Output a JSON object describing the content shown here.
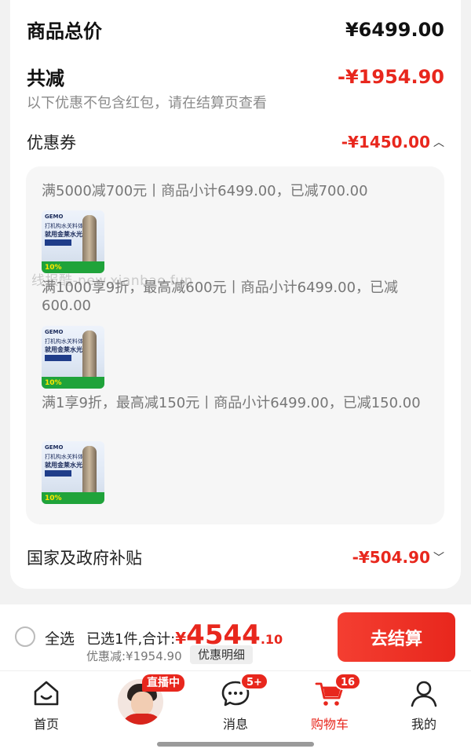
{
  "summary": {
    "total_label": "商品总价",
    "total_value": "¥6499.00",
    "reduce_label": "共减",
    "reduce_value": "-¥1954.90",
    "note": "以下优惠不包含红包，请在结算页查看"
  },
  "coupon": {
    "label": "优惠券",
    "amount": "-¥1450.00",
    "items": [
      {
        "text": "满5000减700元丨商品小计6499.00，已减700.00",
        "thumb_brand": "GEMO",
        "thumb_line1": "打机构水关料体",
        "thumb_line2": "就用金莱水光池",
        "thumb_pct": "10%"
      },
      {
        "text": "满1000享9折，最高减600元丨商品小计6499.00，已减600.00",
        "thumb_brand": "GEMO",
        "thumb_line1": "打机构水关料体",
        "thumb_line2": "就用金莱水光池",
        "thumb_pct": "10%"
      },
      {
        "text": "满1享9折，最高减150元丨商品小计6499.00，已减150.00",
        "thumb_brand": "GEMO",
        "thumb_line1": "打机构水关料体",
        "thumb_line2": "就用金莱水光池",
        "thumb_pct": "10%"
      }
    ]
  },
  "subsidy": {
    "label": "国家及政府补贴",
    "amount": "-¥504.90"
  },
  "watermark": "线报酷-new.xianbao.fun",
  "checkout_bar": {
    "select_all": "全选",
    "selected_prefix": "已选1件,合计:",
    "currency": "¥",
    "total_int": "4544",
    "total_dec": ".10",
    "discount": "优惠减:¥1954.90",
    "detail_button": "优惠明细",
    "checkout_button": "去结算"
  },
  "tabbar": {
    "home": "首页",
    "live_badge": "直播中",
    "messages": "消息",
    "messages_badge": "5+",
    "cart": "购物车",
    "cart_badge": "16",
    "mine": "我的"
  },
  "colors": {
    "accent": "#e8271d",
    "background": "#f2f2f2"
  },
  "icons": [
    "chevron-up-icon",
    "chevron-down-icon",
    "home-icon",
    "message-icon",
    "cart-icon",
    "user-icon"
  ]
}
